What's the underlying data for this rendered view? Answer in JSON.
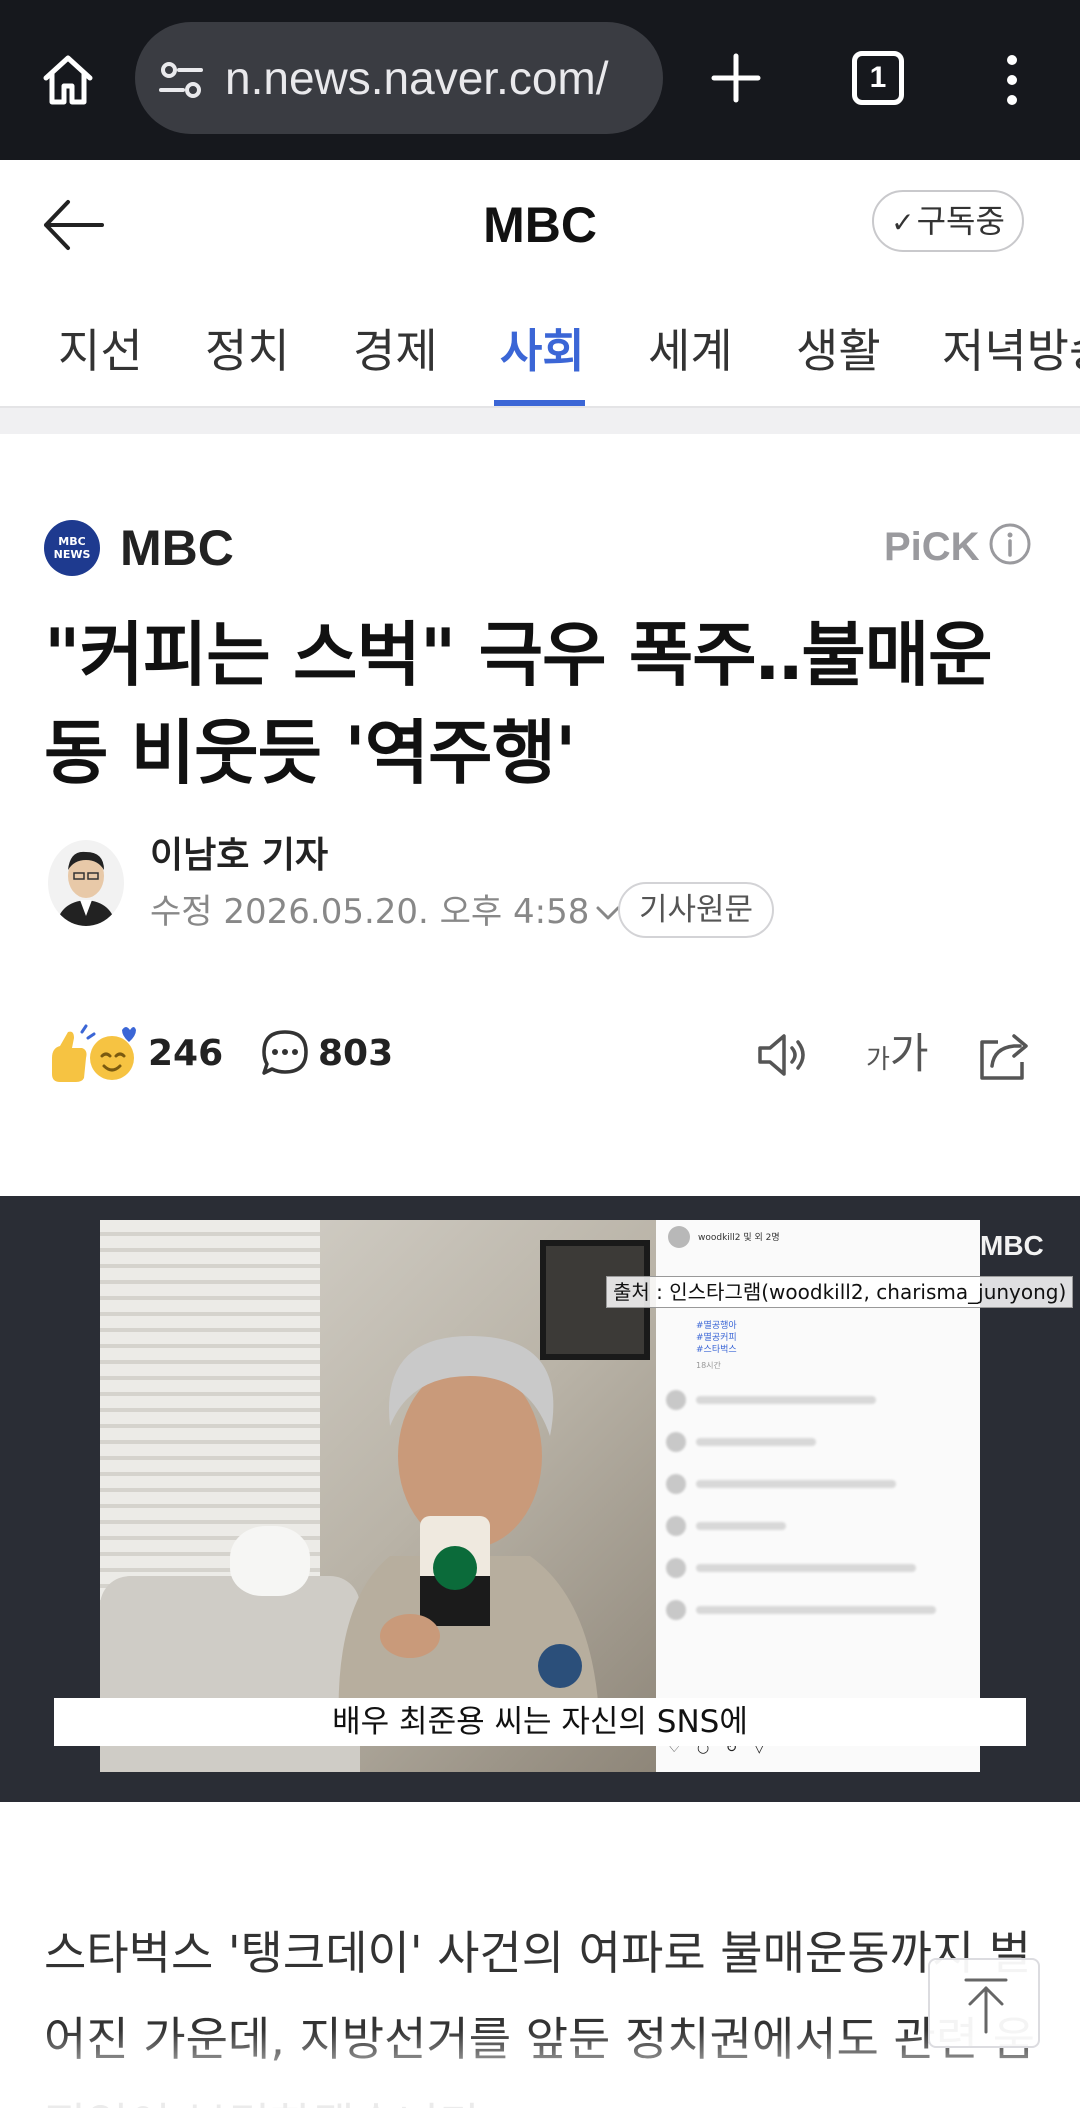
{
  "browser": {
    "url": "n.news.naver.com/",
    "tab_count": "1",
    "icons": [
      "home-icon",
      "site-settings-icon",
      "plus-icon",
      "tab-switcher-icon",
      "more-vert-icon"
    ]
  },
  "header": {
    "title": "MBC",
    "subscribe_label": "구독중",
    "subscribe_check": "✓"
  },
  "categories": [
    {
      "label": "지선",
      "active": false
    },
    {
      "label": "정치",
      "active": false
    },
    {
      "label": "경제",
      "active": false
    },
    {
      "label": "사회",
      "active": true
    },
    {
      "label": "세계",
      "active": false
    },
    {
      "label": "생활",
      "active": false
    },
    {
      "label": "저녁방송",
      "active": false
    }
  ],
  "article": {
    "press_name": "MBC",
    "press_logo_text": "MBC NEWS",
    "pick_label": "PiCK",
    "headline": "\"커피는 스벅\" 극우 폭주‥불매운동 비웃듯 '역주행'",
    "reporter": "이남호 기자",
    "dateline": "수정 2026.05.20. 오후 4:58",
    "origin_button": "기사원문",
    "reactions_count": "246",
    "comments_count": "803",
    "font_size_small": "가",
    "font_size_large": "가"
  },
  "video": {
    "watermark": "MBC",
    "source_caption": "출처 : 인스타그램(woodkill2, charisma_junyong)",
    "subtitle": "배우 최준용 씨는 자신의 SNS에",
    "insta_handle": "woodkill2 및 외 2명",
    "insta_tags": [
      "#멸공행아",
      "#멸공커피",
      "#스타벅스"
    ],
    "insta_time": "18시간"
  },
  "body": {
    "paragraph": "스타벅스 '탱크데이' 사건의 여파로 불매운동까지 벌어진 가운데, 지방선거를 앞둔 정치권에서도 관련 움직임이 본격화됐습니다."
  },
  "colors": {
    "accent": "#3b66d6",
    "chrome_bg": "#16181d",
    "urlbar_bg": "#3a3c42"
  }
}
